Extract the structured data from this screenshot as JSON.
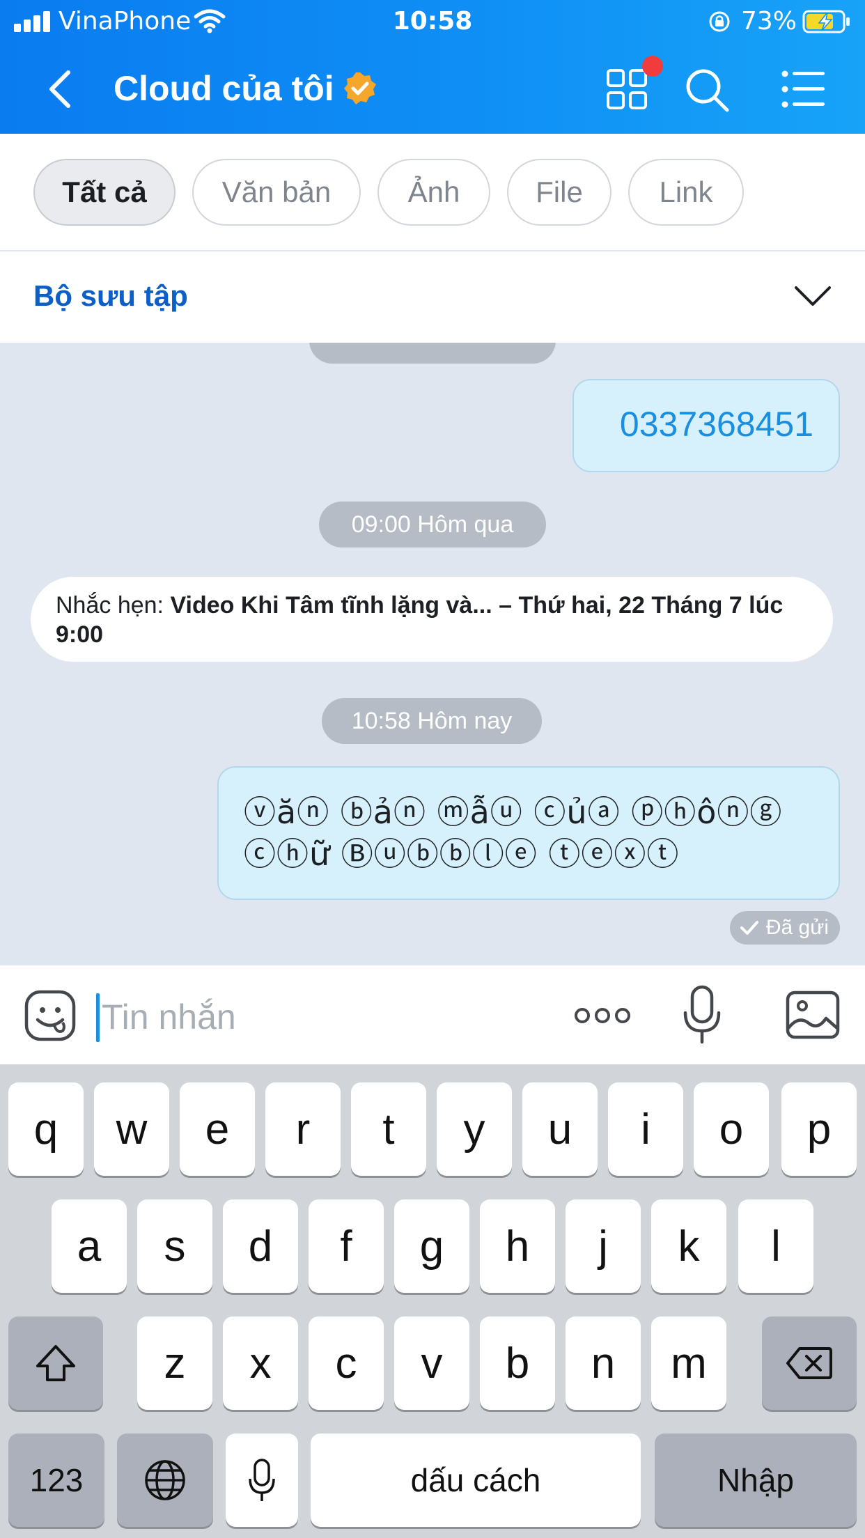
{
  "status": {
    "carrier": "VinaPhone",
    "time": "10:58",
    "battery": "73%"
  },
  "nav": {
    "title": "Cloud của tôi"
  },
  "filters": [
    {
      "label": "Tất cả",
      "active": true
    },
    {
      "label": "Văn bản",
      "active": false
    },
    {
      "label": "Ảnh",
      "active": false
    },
    {
      "label": "File",
      "active": false
    },
    {
      "label": "Link",
      "active": false
    }
  ],
  "collection": {
    "label": "Bộ sưu tập"
  },
  "chat": {
    "messages": {
      "phone": "0337368451",
      "time_yesterday": "09:00 Hôm qua",
      "reminder_prefix": "Nhắc hẹn: ",
      "reminder_body": "Video Khi Tâm tĩnh lặng và... – Thứ hai, 22 Tháng 7 lúc 9:00",
      "time_today": "10:58 Hôm nay",
      "fancy_text": "ⓥăⓝ ⓑảⓝ ⓜẫⓤ ⓒủⓐ ⓟⓗôⓝⓖ ⓒⓗữ Ⓑⓤⓑⓑⓛⓔ ⓣⓔⓧⓣ",
      "sent_status": "Đã gửi"
    }
  },
  "input": {
    "placeholder": "Tin nhắn"
  },
  "keyboard": {
    "row1": [
      "q",
      "w",
      "e",
      "r",
      "t",
      "y",
      "u",
      "i",
      "o",
      "p"
    ],
    "row2": [
      "a",
      "s",
      "d",
      "f",
      "g",
      "h",
      "j",
      "k",
      "l"
    ],
    "row3": [
      "z",
      "x",
      "c",
      "v",
      "b",
      "n",
      "m"
    ],
    "numbers": "123",
    "space": "dấu cách",
    "return": "Nhập"
  },
  "colors": {
    "header": "#0f8ff5",
    "accent": "#1a8fe0",
    "bubble": "#d6f0fc"
  }
}
